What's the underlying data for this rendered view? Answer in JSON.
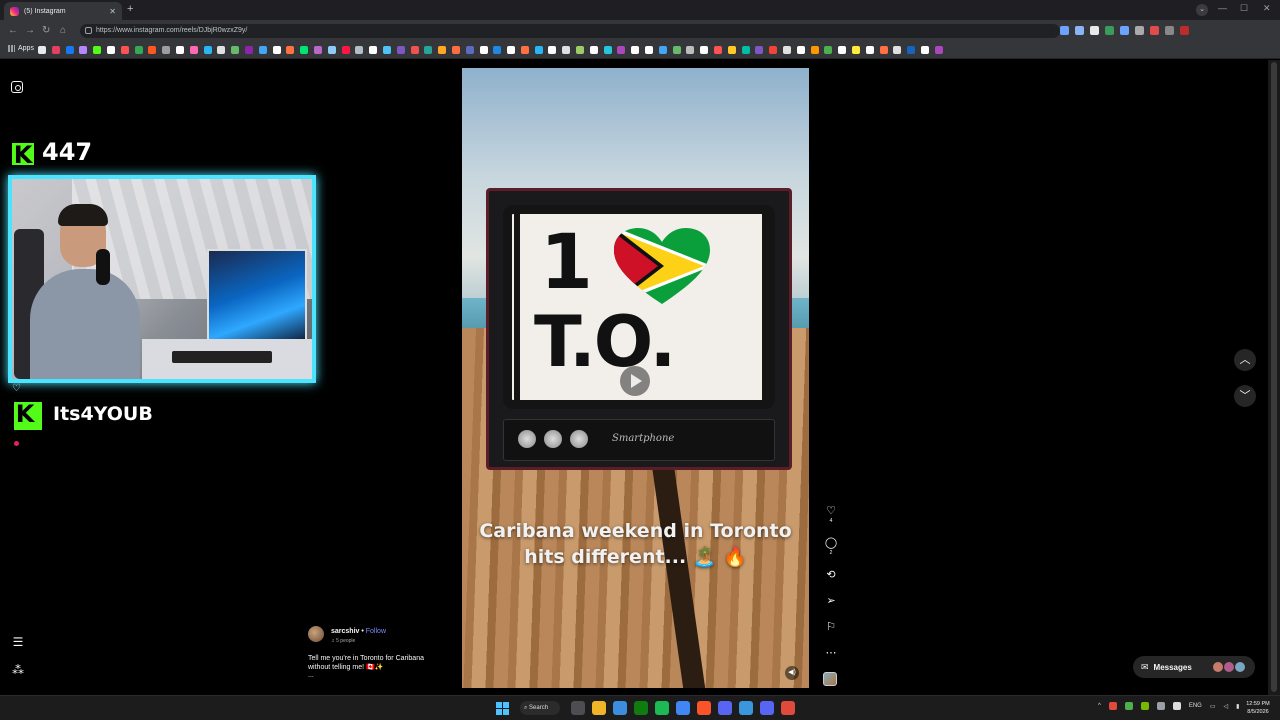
{
  "browser": {
    "tab_title": "(5) Instagram",
    "url": "https://www.instagram.com/reels/DJbjR0wzxZ9y/",
    "bookmarks_apps_label": "Apps",
    "extension_colors": [
      "#6ba3ff",
      "#8ab4f8",
      "#e9e9e9",
      "#3a9b5c",
      "#6ba3ff",
      "#aaaaaa",
      "#e24b4b",
      "#888888",
      "#bf2b2b"
    ],
    "bookmark_colors": [
      "#e8eaed",
      "#e4405f",
      "#1877f2",
      "#b388ff",
      "#53fc18",
      "#ffffff",
      "#ff5252",
      "#34a853",
      "#ff5722",
      "#9e9e9e",
      "#ffffff",
      "#ff69b4",
      "#29b6f6",
      "#e0e0e0",
      "#66bb6a",
      "#8e24aa",
      "#42a5f5",
      "#ffffff",
      "#ff7043",
      "#00e676",
      "#ba68c8",
      "#90caf9",
      "#ff1744",
      "#b0bec5",
      "#ffffff",
      "#4fc3f7",
      "#7e57c2",
      "#ef5350",
      "#26a69a",
      "#ffa726",
      "#ff6e40",
      "#5c6bc0",
      "#ffffff",
      "#1e88e5",
      "#ffffff",
      "#ff7043",
      "#29b6f6",
      "#ffffff",
      "#e0e0e0",
      "#9ccc65",
      "#ffffff",
      "#26c6da",
      "#ab47bc",
      "#ffffff",
      "#ffffff",
      "#42a5f5",
      "#66bb6a",
      "#bdbdbd",
      "#ffffff",
      "#ff5252",
      "#ffca28",
      "#00bfa5",
      "#7e57c2",
      "#f44336",
      "#e0e0e0",
      "#ffffff",
      "#ff9800",
      "#4caf50",
      "#ffffff",
      "#ffeb3b",
      "#ffffff",
      "#ff7043",
      "#e0e0e0",
      "#1565c0",
      "#ffffff",
      "#ab47bc"
    ]
  },
  "stream": {
    "viewer_count": "447",
    "streamer_name": "Its4YOUB",
    "accent": "#53fc18",
    "cam_border": "#4ce3ff"
  },
  "reel": {
    "tv_line1": "1",
    "tv_line2": "T.O.",
    "tv_brand": "Smartphone",
    "caption_line1": "Caribana weekend in Toronto",
    "caption_line2": "hits different... 🏝️ 🔥"
  },
  "post": {
    "username": "sarcshiv",
    "follow_label": "Follow",
    "audio": "♫ 5 people",
    "caption": "Tell me you're in Toronto for Caribana without telling me! 🇨🇦✨",
    "more": "..."
  },
  "actions": {
    "likes": "4",
    "comments": "2",
    "more_icon": "⋯"
  },
  "messages": {
    "label": "Messages"
  },
  "taskbar": {
    "search_label": "Search",
    "lang": "ENG",
    "time": "12:59 PM",
    "date": "8/5/2026",
    "app_colors": [
      "#4e4e52",
      "#f0b429",
      "#3c8dde",
      "#107c10",
      "#1db954",
      "#4285f4",
      "#fb542b",
      "#5865f2",
      "#3a96dd",
      "#5865f2",
      "#e04a3a"
    ]
  }
}
